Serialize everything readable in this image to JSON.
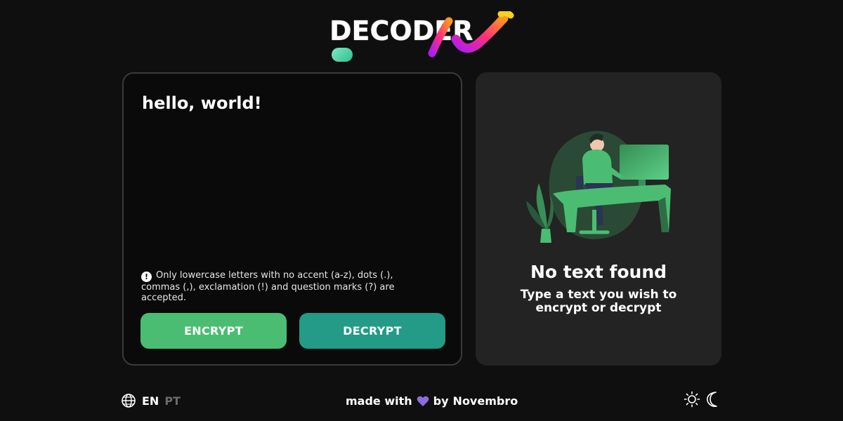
{
  "header": {
    "logo_text": "DECODER"
  },
  "input_panel": {
    "text_value": "hello, world!",
    "notice_text": "Only lowercase letters with no accent (a-z), dots (.), commas (,), exclamation (!) and question marks (?) are accepted.",
    "encrypt_label": "ENCRYPT",
    "decrypt_label": "DECRYPT"
  },
  "output_panel": {
    "title": "No text found",
    "subtitle": "Type a text you wish to encrypt or decrypt"
  },
  "footer": {
    "lang_active": "EN",
    "lang_inactive": "PT",
    "made_with": "made with",
    "by_label": "by",
    "author": "Novembro"
  },
  "colors": {
    "encrypt": "#4bbd73",
    "decrypt": "#239b86",
    "heart": "#8a6ee0",
    "accent_green": "#3fbf7a"
  },
  "icons": [
    "globe-icon",
    "heart-icon",
    "sun-icon",
    "moon-icon",
    "info-icon"
  ]
}
